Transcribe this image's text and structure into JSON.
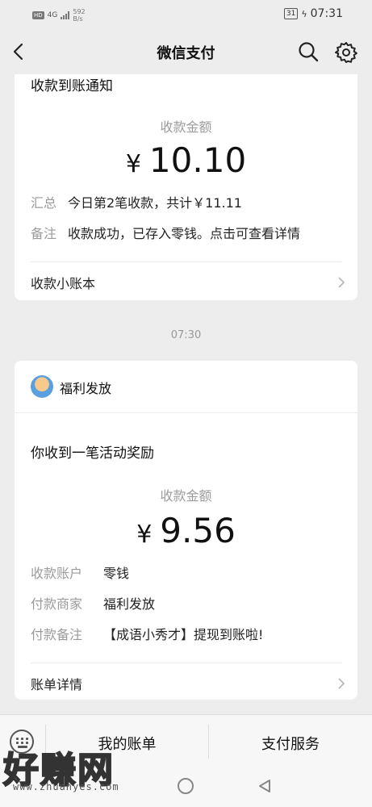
{
  "status_bar": {
    "hd": "HD",
    "network": "4G",
    "speed_value": "592",
    "speed_unit": "B/s",
    "battery": "31",
    "time": "07:31"
  },
  "nav": {
    "title": "微信支付"
  },
  "card1": {
    "title": "收款到账通知",
    "amount_label": "收款金额",
    "currency": "¥",
    "amount": "10.10",
    "rows": [
      {
        "key": "汇总",
        "value": "今日第2笔收款，共计￥11.11"
      },
      {
        "key": "备注",
        "value": "收款成功，已存入零钱。点击可查看详情"
      }
    ],
    "link": "收款小账本"
  },
  "time_separator": "07:30",
  "card2": {
    "merchant": "福利发放",
    "title": "你收到一笔活动奖励",
    "amount_label": "收款金额",
    "currency": "¥",
    "amount": "9.56",
    "rows": [
      {
        "key": "收款账户",
        "value": "零钱"
      },
      {
        "key": "付款商家",
        "value": "福利发放"
      },
      {
        "key": "付款备注",
        "value": "【成语小秀才】提现到账啦!"
      }
    ],
    "link": "账单详情"
  },
  "bottom_menu": {
    "item1": "我的账单",
    "item2": "支付服务"
  },
  "watermark": {
    "main": "好赚网",
    "sub": "www.zhuanyes.com"
  },
  "icons": {
    "back": "chevron-left-icon",
    "search": "search-icon",
    "settings": "gear-icon",
    "keyboard": "keyboard-icon",
    "home": "circle-home-icon",
    "sysback": "triangle-back-icon"
  }
}
